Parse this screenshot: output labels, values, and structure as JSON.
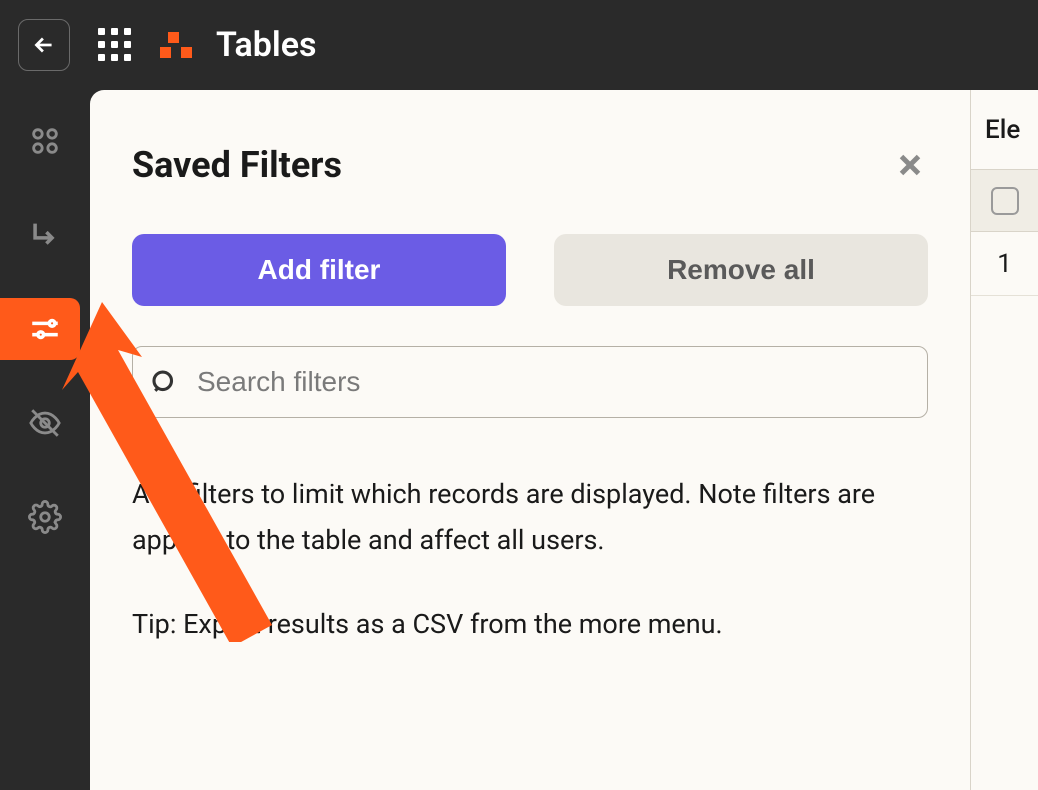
{
  "header": {
    "title": "Tables"
  },
  "panel": {
    "title": "Saved Filters",
    "add_filter_label": "Add filter",
    "remove_all_label": "Remove all",
    "search_placeholder": "Search filters",
    "help_line1": "Add filters to limit which records are displayed. Note filters are applied to the table and affect all users.",
    "help_line2": "Tip: Export results as a CSV from the more menu."
  },
  "right": {
    "header_fragment": "Ele",
    "row_number": "1"
  },
  "colors": {
    "accent_orange": "#ff5a1a",
    "accent_purple": "#6b5ce5",
    "bg_dark": "#2a2a2a",
    "bg_light": "#fcfaf6"
  }
}
